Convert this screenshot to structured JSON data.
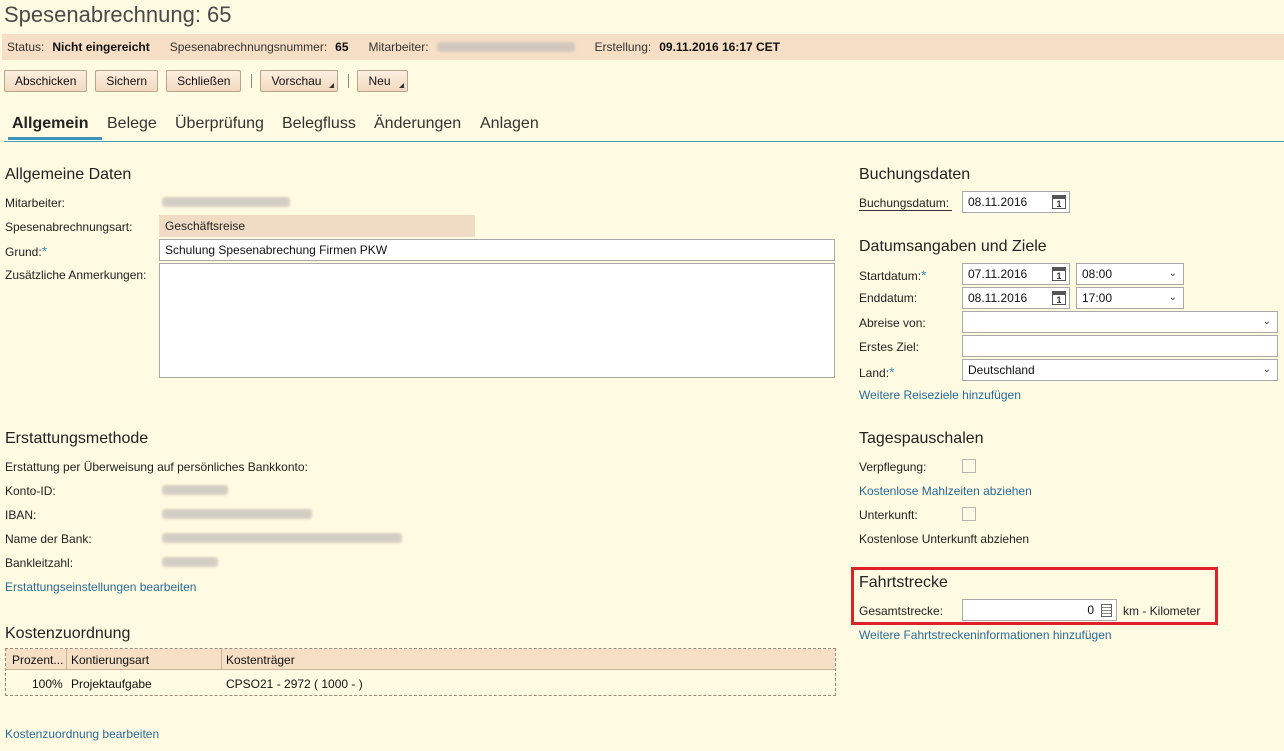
{
  "page": {
    "title": "Spesenabrechnung: 65"
  },
  "status": {
    "status_label": "Status:",
    "status_value": "Nicht eingereicht",
    "number_label": "Spesenabrechnungsnummer:",
    "number_value": "65",
    "employee_label": "Mitarbeiter:",
    "created_label": "Erstellung:",
    "created_value": "09.11.2016 16:17 CET"
  },
  "toolbar": {
    "submit": "Abschicken",
    "save": "Sichern",
    "close": "Schließen",
    "preview": "Vorschau",
    "new": "Neu"
  },
  "tabs": [
    "Allgemein",
    "Belege",
    "Überprüfung",
    "Belegfluss",
    "Änderungen",
    "Anlagen"
  ],
  "general": {
    "heading": "Allgemeine Daten",
    "employee_label": "Mitarbeiter:",
    "type_label": "Spesenabrechnungsart:",
    "type_value": "Geschäftsreise",
    "reason_label": "Grund:",
    "reason_value": "Schulung Spesenabrechung Firmen PKW",
    "notes_label": "Zusätzliche Anmerkungen:",
    "notes_value": ""
  },
  "reimbursement": {
    "heading": "Erstattungsmethode",
    "method": "Erstattung per Überweisung auf persönliches Bankkonto:",
    "account_label": "Konto-ID:",
    "iban_label": "IBAN:",
    "bank_label": "Name der Bank:",
    "blz_label": "Bankleitzahl:",
    "edit_link": "Erstattungseinstellungen bearbeiten"
  },
  "cost": {
    "heading": "Kostenzuordnung",
    "columns": [
      "Prozent...",
      "Kontierungsart",
      "Kostenträger"
    ],
    "rows": [
      [
        "100%",
        "Projektaufgabe",
        "CPSO21 - 2972 ( 1000 -  )"
      ]
    ],
    "edit_link": "Kostenzuordnung bearbeiten"
  },
  "booking": {
    "heading": "Buchungsdaten",
    "date_label": "Buchungsdatum:",
    "date_value": "08.11.2016"
  },
  "dates": {
    "heading": "Datumsangaben und Ziele",
    "start_label": "Startdatum:",
    "start_date": "07.11.2016",
    "start_time": "08:00",
    "end_label": "Enddatum:",
    "end_date": "08.11.2016",
    "end_time": "17:00",
    "departure_label": "Abreise von:",
    "departure_value": "",
    "first_dest_label": "Erstes Ziel:",
    "first_dest_value": "",
    "country_label": "Land:",
    "country_value": "Deutschland",
    "add_link": "Weitere Reiseziele hinzufügen"
  },
  "allowance": {
    "heading": "Tagespauschalen",
    "meals_label": "Verpflegung:",
    "meals_checked": false,
    "meals_link": "Kostenlose Mahlzeiten abziehen",
    "lodging_label": "Unterkunft:",
    "lodging_checked": false,
    "lodging_text": "Kostenlose Unterkunft abziehen"
  },
  "distance": {
    "heading": "Fahrtstrecke",
    "total_label": "Gesamtstrecke:",
    "total_value": "0",
    "unit": "km - Kilometer",
    "add_link": "Weitere Fahrtstreckeninformationen hinzufügen"
  },
  "colors": {
    "accent": "#3f93b8",
    "header_bg": "#f6dfc5",
    "page_bg": "#fffbe2",
    "highlight": "#e0202a"
  }
}
